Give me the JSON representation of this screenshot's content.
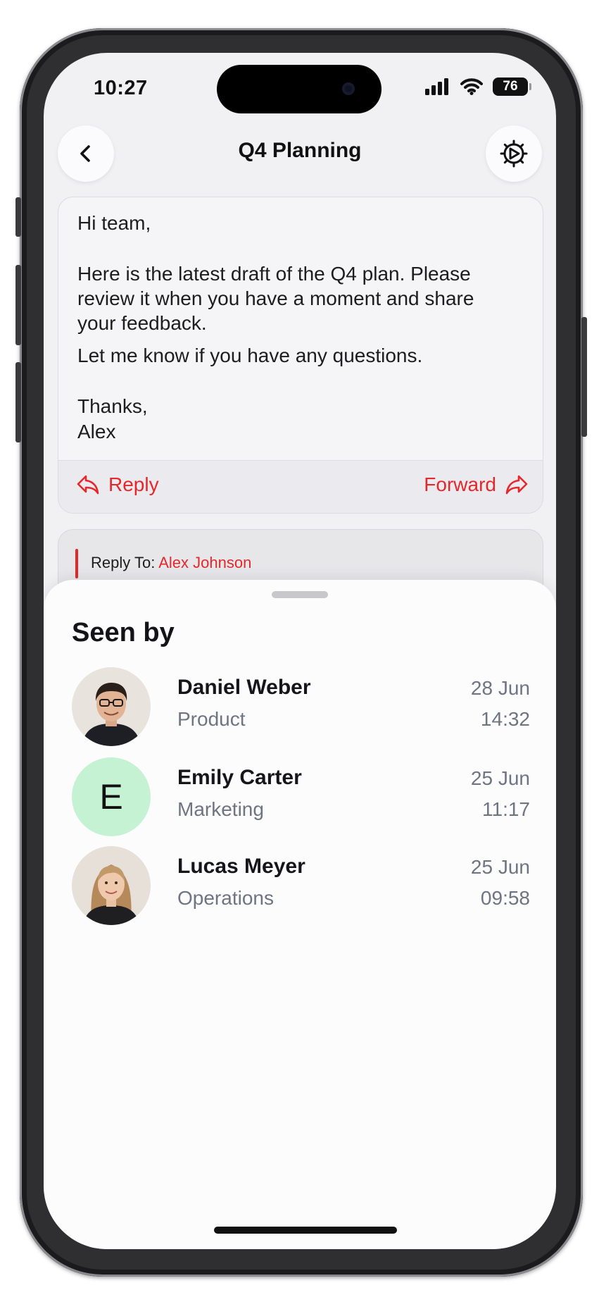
{
  "status_bar": {
    "time": "10:27",
    "battery": "76"
  },
  "nav": {
    "title": "Q4 Planning"
  },
  "message": {
    "greeting": "Hi team,",
    "para1_line1": "Here is the latest draft of the Q4 plan. Please",
    "para1_line2": "review it when you have a moment and share",
    "para1_line3": "your feedback.",
    "para2": "Let me know if you have any questions.",
    "signoff": "Thanks,",
    "signature": "Alex"
  },
  "actions": {
    "reply_label": "Reply",
    "forward_label": "Forward"
  },
  "reply_to": {
    "label": "Reply To:",
    "name": "Alex Johnson"
  },
  "sheet": {
    "title": "Seen by",
    "viewers": [
      {
        "name": "Daniel Weber",
        "department": "Product",
        "date": "28 Jun",
        "time": "14:32",
        "avatar": "photo"
      },
      {
        "name": "Emily Carter",
        "department": "Marketing",
        "date": "25 Jun",
        "time": "11:17",
        "avatar": "initial",
        "initial": "E"
      },
      {
        "name": "Lucas Meyer",
        "department": "Operations",
        "date": "25 Jun",
        "time": "09:58",
        "avatar": "photo"
      }
    ]
  },
  "colors": {
    "accent": "#e4282b",
    "initial_avatar_bg": "#c5f2d3",
    "secondary_text": "#6f7482"
  }
}
